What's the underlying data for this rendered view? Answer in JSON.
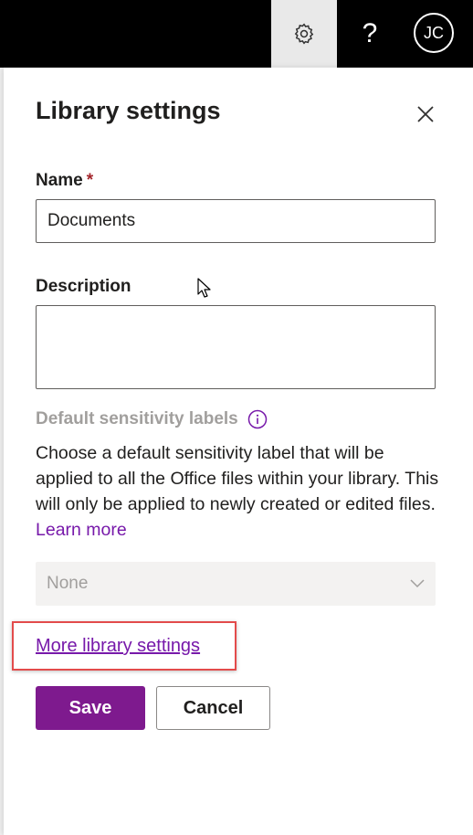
{
  "topbar": {
    "avatar_initials": "JC",
    "help_label": "?",
    "icons": [
      "gear-icon",
      "help-icon"
    ]
  },
  "panel": {
    "title": "Library settings",
    "close_icon": "close-icon"
  },
  "name_field": {
    "label": "Name",
    "required_marker": "*",
    "value": "Documents"
  },
  "description_field": {
    "label": "Description",
    "value": ""
  },
  "sensitivity": {
    "label": "Default sensitivity labels",
    "description": "Choose a default sensitivity label that will be applied to all the Office files within your library. This will only be applied to newly created or edited files.",
    "learn_more": "Learn more",
    "dropdown_value": "None"
  },
  "more_settings_link": "More library settings",
  "buttons": {
    "save": "Save",
    "cancel": "Cancel"
  },
  "colors": {
    "accent": "#7e1a8e",
    "link": "#7719aa",
    "highlight_box": "#e34b4b",
    "required": "#a4262c"
  }
}
